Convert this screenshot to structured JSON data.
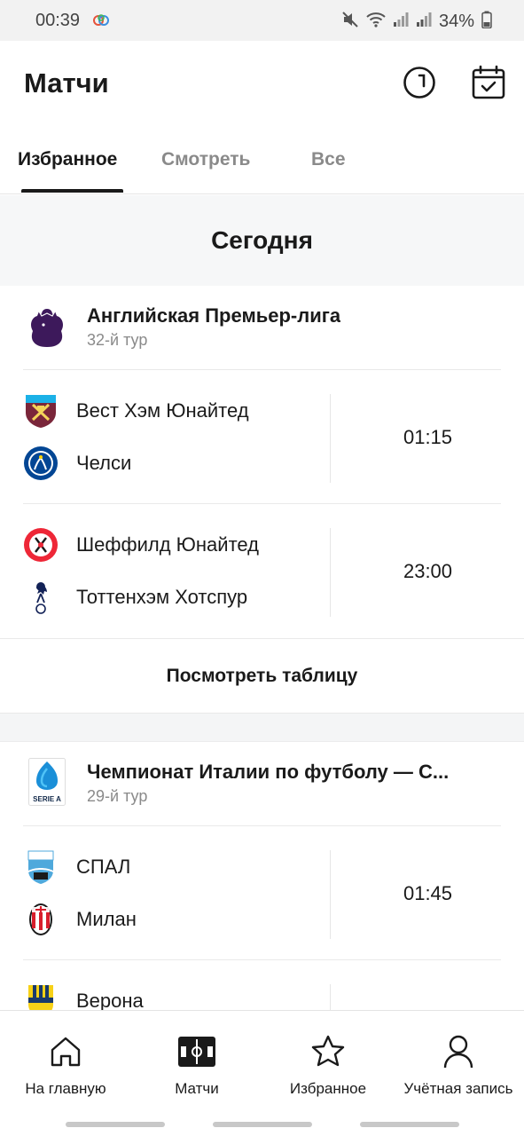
{
  "status_bar": {
    "time": "00:39",
    "battery": "34%",
    "icons": [
      "mute-icon",
      "wifi-icon",
      "signal-icon",
      "signal-icon",
      "battery-icon"
    ]
  },
  "header": {
    "title": "Матчи",
    "icons": [
      "clock-icon",
      "calendar-icon"
    ]
  },
  "tabs": [
    {
      "label": "Избранное",
      "active": true
    },
    {
      "label": "Смотреть",
      "active": false
    },
    {
      "label": "Все",
      "active": false
    }
  ],
  "day": {
    "title": "Сегодня"
  },
  "competitions": [
    {
      "name": "Английская Премьер-лига",
      "round": "32-й тур",
      "logo": "premier-league-logo",
      "matches": [
        {
          "home": "Вест Хэм Юнайтед",
          "away": "Челси",
          "time": "01:15"
        },
        {
          "home": "Шеффилд Юнайтед",
          "away": "Тоттенхэм Хотспур",
          "time": "23:00"
        }
      ],
      "table_link": "Посмотреть таблицу"
    },
    {
      "name": "Чемпионат Италии по футболу — С...",
      "round": "29-й тур",
      "logo": "serie-a-logo",
      "logo_text": "SERIE A",
      "matches": [
        {
          "home": "СПАЛ",
          "away": "Милан",
          "time": "01:45"
        },
        {
          "home": "Верона",
          "away": "",
          "time": ""
        }
      ]
    }
  ],
  "bottom_nav": [
    {
      "label": "На главную",
      "icon": "home-icon",
      "active": false
    },
    {
      "label": "Матчи",
      "icon": "pitch-icon",
      "active": true
    },
    {
      "label": "Избранное",
      "icon": "star-icon",
      "active": false
    },
    {
      "label": "Учётная запись",
      "icon": "user-icon",
      "active": false
    }
  ],
  "colors": {
    "text": "#1a1a1a",
    "muted": "#8a8a8a",
    "band": "#f6f7f8",
    "divider": "#e9e9e9",
    "pl_purple": "#3d195b",
    "westham_claret": "#7a263a",
    "chelsea_blue": "#034694",
    "sheffield_red": "#ee2737",
    "spal_blue": "#4fa9dc",
    "milan_red": "#d81e2c",
    "verona_yellow": "#f7d117"
  }
}
